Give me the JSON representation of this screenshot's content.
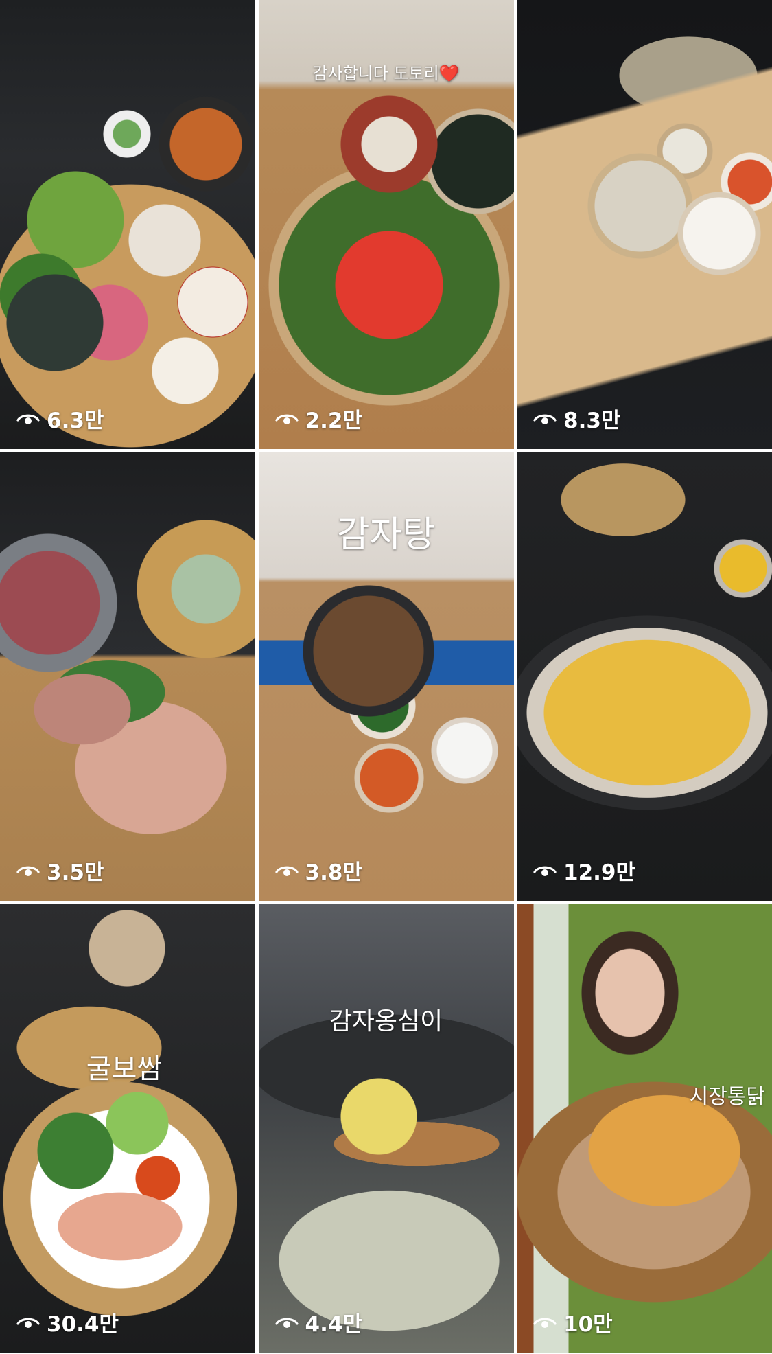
{
  "feed": {
    "tiles": [
      {
        "caption": "",
        "views": "6.3만"
      },
      {
        "caption": "감사합니다 도토리❤️",
        "views": "2.2만"
      },
      {
        "caption": "",
        "views": "8.3만"
      },
      {
        "caption": "",
        "views": "3.5만"
      },
      {
        "caption": "감자탕",
        "views": "3.8만"
      },
      {
        "caption": "",
        "views": "12.9만"
      },
      {
        "caption": "굴보쌈",
        "views": "30.4만"
      },
      {
        "caption": "감자옹심이",
        "views": "4.4만"
      },
      {
        "caption": "시장통닭",
        "views": "10만"
      }
    ],
    "view_icon": "eye-icon"
  }
}
